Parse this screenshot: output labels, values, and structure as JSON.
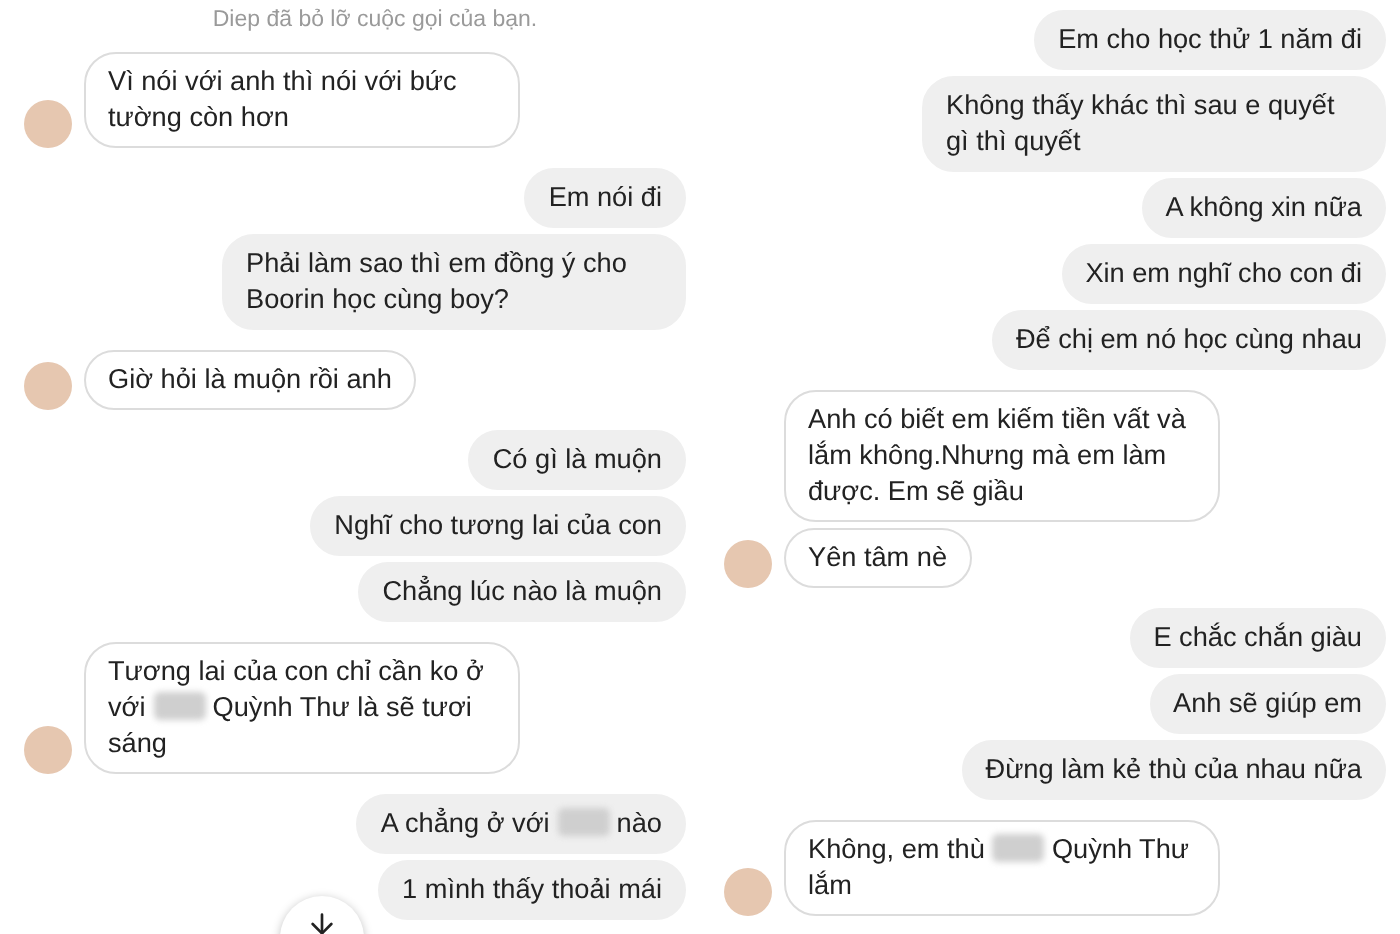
{
  "panels": [
    {
      "system_note": "Diep đã bỏ lỡ cuộc gọi của bạn.",
      "scroll_button": true,
      "messages": [
        {
          "outgoing": false,
          "segments": [
            {
              "kind": "text",
              "text": "Vì nói với anh thì nói với bức tường còn hơn"
            }
          ]
        },
        {
          "outgoing": true,
          "segments": [
            {
              "kind": "text",
              "text": "Em nói đi"
            }
          ]
        },
        {
          "outgoing": true,
          "segments": [
            {
              "kind": "text",
              "text": "Phải làm sao thì em đồng ý cho Boorin học cùng boy?"
            }
          ]
        },
        {
          "outgoing": false,
          "segments": [
            {
              "kind": "text",
              "text": "Giờ hỏi là muộn rồi anh"
            }
          ]
        },
        {
          "outgoing": true,
          "segments": [
            {
              "kind": "text",
              "text": "Có gì là muộn"
            }
          ]
        },
        {
          "outgoing": true,
          "segments": [
            {
              "kind": "text",
              "text": "Nghĩ cho tương lai của con"
            }
          ]
        },
        {
          "outgoing": true,
          "segments": [
            {
              "kind": "text",
              "text": "Chẳng lúc nào là muộn"
            }
          ]
        },
        {
          "outgoing": false,
          "segments": [
            {
              "kind": "text",
              "text": "Tương lai của con chỉ cần ko ở với "
            },
            {
              "kind": "redacted"
            },
            {
              "kind": "text",
              "text": " Quỳnh Thư là sẽ tươi sáng"
            }
          ]
        },
        {
          "outgoing": true,
          "segments": [
            {
              "kind": "text",
              "text": "A chẳng ở với "
            },
            {
              "kind": "redacted"
            },
            {
              "kind": "text",
              "text": " nào"
            }
          ]
        },
        {
          "outgoing": true,
          "segments": [
            {
              "kind": "text",
              "text": "1 mình thấy thoải mái"
            }
          ]
        }
      ]
    },
    {
      "messages": [
        {
          "outgoing": true,
          "segments": [
            {
              "kind": "text",
              "text": "Em cho học thử 1 năm đi"
            }
          ]
        },
        {
          "outgoing": true,
          "segments": [
            {
              "kind": "text",
              "text": "Không thấy khác thì sau e quyết gì thì quyết"
            }
          ]
        },
        {
          "outgoing": true,
          "segments": [
            {
              "kind": "text",
              "text": "A không xin nữa"
            }
          ]
        },
        {
          "outgoing": true,
          "segments": [
            {
              "kind": "text",
              "text": "Xin em nghĩ cho con đi"
            }
          ]
        },
        {
          "outgoing": true,
          "segments": [
            {
              "kind": "text",
              "text": "Để chị em nó học cùng nhau"
            }
          ]
        },
        {
          "outgoing": false,
          "segments": [
            {
              "kind": "text",
              "text": "Anh có biết em kiếm tiền vất và lắm không.Nhưng mà em làm được. Em sẽ giầu"
            }
          ]
        },
        {
          "outgoing": false,
          "segments": [
            {
              "kind": "text",
              "text": "Yên tâm nè"
            }
          ]
        },
        {
          "outgoing": true,
          "segments": [
            {
              "kind": "text",
              "text": "E chắc chắn giàu"
            }
          ]
        },
        {
          "outgoing": true,
          "segments": [
            {
              "kind": "text",
              "text": "Anh sẽ giúp em"
            }
          ]
        },
        {
          "outgoing": true,
          "segments": [
            {
              "kind": "text",
              "text": "Đừng làm kẻ thù của nhau nữa"
            }
          ]
        },
        {
          "outgoing": false,
          "segments": [
            {
              "kind": "text",
              "text": "Không, em thù "
            },
            {
              "kind": "redacted"
            },
            {
              "kind": "text",
              "text": " Quỳnh Thư lắm"
            }
          ]
        }
      ]
    }
  ]
}
